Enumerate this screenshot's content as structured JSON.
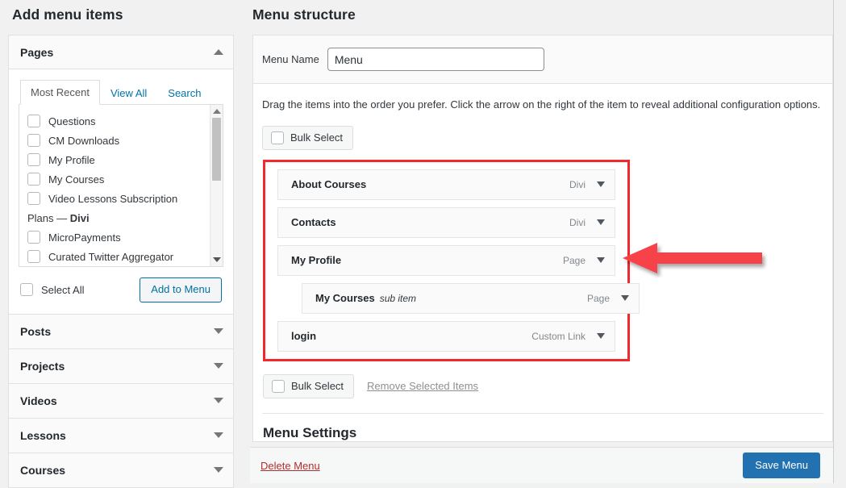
{
  "left": {
    "title": "Add menu items",
    "panels": [
      {
        "label": "Pages",
        "expanded": true
      },
      {
        "label": "Posts",
        "expanded": false
      },
      {
        "label": "Projects",
        "expanded": false
      },
      {
        "label": "Videos",
        "expanded": false
      },
      {
        "label": "Lessons",
        "expanded": false
      },
      {
        "label": "Courses",
        "expanded": false
      }
    ],
    "tabs": [
      {
        "label": "Most Recent",
        "active": true
      },
      {
        "label": "View All",
        "active": false
      },
      {
        "label": "Search",
        "active": false
      }
    ],
    "page_items": [
      {
        "label": "Questions",
        "type": "checkbox"
      },
      {
        "label": "CM Downloads",
        "type": "checkbox"
      },
      {
        "label": "My Profile",
        "type": "checkbox"
      },
      {
        "label": "My Courses",
        "type": "checkbox"
      },
      {
        "label": "Video Lessons Subscription",
        "type": "checkbox"
      },
      {
        "label": "Plans — Divi",
        "type": "group"
      },
      {
        "label": "MicroPayments",
        "type": "checkbox"
      },
      {
        "label": "Curated Twitter Aggregator",
        "type": "checkbox"
      }
    ],
    "select_all_label": "Select All",
    "add_to_menu_label": "Add to Menu"
  },
  "right": {
    "title": "Menu structure",
    "menu_name_label": "Menu Name",
    "menu_name_value": "Menu",
    "menu_name_placeholder": "Menu Name",
    "help_text": "Drag the items into the order you prefer. Click the arrow on the right of the item to reveal additional configuration options.",
    "bulk_select_label": "Bulk Select",
    "bulk_select_label_bottom": "Bulk Select",
    "remove_selected_label": "Remove Selected Items",
    "menu_settings_title": "Menu Settings",
    "menu_items": [
      {
        "title": "About Courses",
        "type": "Divi",
        "sub": false,
        "sub_note": ""
      },
      {
        "title": "Contacts",
        "type": "Divi",
        "sub": false,
        "sub_note": ""
      },
      {
        "title": "My Profile",
        "type": "Page",
        "sub": false,
        "sub_note": ""
      },
      {
        "title": "My Courses",
        "type": "Page",
        "sub": true,
        "sub_note": "sub item"
      },
      {
        "title": "login",
        "type": "Custom Link",
        "sub": false,
        "sub_note": ""
      }
    ]
  },
  "bottom": {
    "delete_label": "Delete Menu",
    "save_label": "Save Menu"
  },
  "annotation": {
    "arrow_color": "#f8434a",
    "highlight_color": "#f2282c",
    "direction": "left"
  }
}
